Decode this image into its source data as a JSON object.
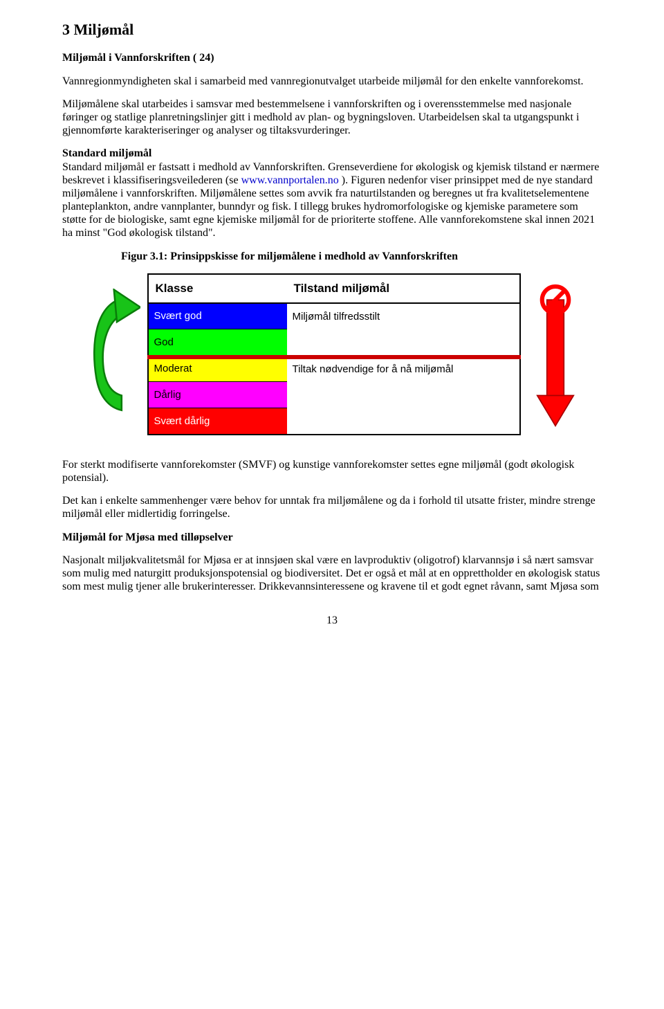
{
  "h1": "3  Miljømål",
  "sub1": "Miljømål i Vannforskriften ( 24)",
  "p1": "Vannregionmyndigheten skal i samarbeid med vannregionutvalget utarbeide miljømål for den enkelte vannforekomst.",
  "p2": "Miljømålene skal utarbeides i samsvar med bestemmelsene i vannforskriften og i overensstemmelse med nasjonale føringer og statlige planretningslinjer gitt i medhold av plan- og bygningsloven. Utarbeidelsen skal ta utgangspunkt i gjennomførte karakteriseringer og analyser og tiltaksvurderinger.",
  "sub2": "Standard miljømål",
  "p3a": "Standard miljømål er fastsatt i medhold av Vannforskriften. Grenseverdiene for økologisk og kjemisk tilstand er nærmere beskrevet i klassifiseringsveilederen (se ",
  "p3link": "www.vannportalen.no",
  "p3b": " ). Figuren nedenfor viser prinsippet med de nye standard miljømålene i vannforskriften. Miljømålene settes som avvik fra naturtilstanden og beregnes ut fra kvalitetselementene planteplankton, andre vannplanter, bunndyr og fisk. I tillegg brukes hydromorfologiske og kjemiske parametere som støtte for de biologiske, samt egne kjemiske miljømål for de prioriterte stoffene. Alle vannforekomstene skal innen 2021 ha minst \"God økologisk tilstand\".",
  "fig_caption": "Figur 3.1: Prinsippskisse for miljømålene i medhold av Vannforskriften",
  "p4": "For sterkt modifiserte vannforekomster (SMVF) og kunstige vannforekomster settes egne miljømål (godt økologisk potensial).",
  "p5": "Det kan i enkelte sammenhenger være behov for unntak fra miljømålene og da i forhold til utsatte frister, mindre strenge miljømål eller midlertidig forringelse.",
  "sub3": "Miljømål for Mjøsa med tilløpselver",
  "p6": "Nasjonalt miljøkvalitetsmål for Mjøsa er at innsjøen skal være en lavproduktiv (oligotrof) klarvannsjø i så nært samsvar som mulig med naturgitt produksjonspotensial og biodiversitet. Det er også et mål at en opprettholder en økologisk status som mest mulig tjener alle brukerinteresser. Drikkevannsinteressene og kravene til et godt egnet råvann, samt Mjøsa som",
  "page_num": "13",
  "chart_data": {
    "type": "table",
    "header_left": "Klasse",
    "header_right": "Tilstand miljømål",
    "rows": [
      {
        "label": "Svært god",
        "color": "blue"
      },
      {
        "label": "God",
        "color": "green"
      },
      {
        "label": "Moderat",
        "color": "yellow"
      },
      {
        "label": "Dårlig",
        "color": "magenta"
      },
      {
        "label": "Svært dårlig",
        "color": "red"
      }
    ],
    "right_top": "Miljømål tilfredsstilt",
    "right_bottom": "Tiltak nødvendige for å nå miljømål"
  }
}
